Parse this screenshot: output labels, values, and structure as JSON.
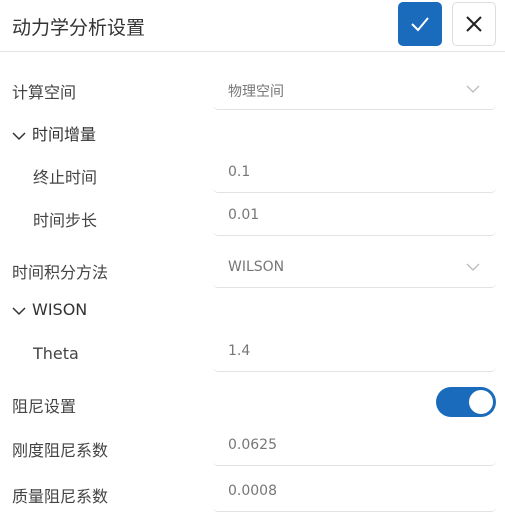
{
  "header": {
    "title": "动力学分析设置",
    "confirm_icon": "check-icon",
    "close_icon": "close-icon"
  },
  "accent": "#1b6bbd",
  "form": {
    "calc_space": {
      "label": "计算空间",
      "value": "物理空间"
    },
    "time_increment": {
      "label": "时间增量"
    },
    "end_time": {
      "label": "终止时间",
      "value": "0.1"
    },
    "time_step": {
      "label": "时间步长",
      "value": "0.01"
    },
    "integration_method": {
      "label": "时间积分方法",
      "value": "WILSON"
    },
    "wison": {
      "label": "WISON"
    },
    "theta": {
      "label": "Theta",
      "value": "1.4"
    },
    "damping": {
      "label": "阻尼设置",
      "enabled": true
    },
    "stiffness_damping": {
      "label": "刚度阻尼系数",
      "value": "0.0625"
    },
    "mass_damping": {
      "label": "质量阻尼系数",
      "value": "0.0008"
    }
  }
}
